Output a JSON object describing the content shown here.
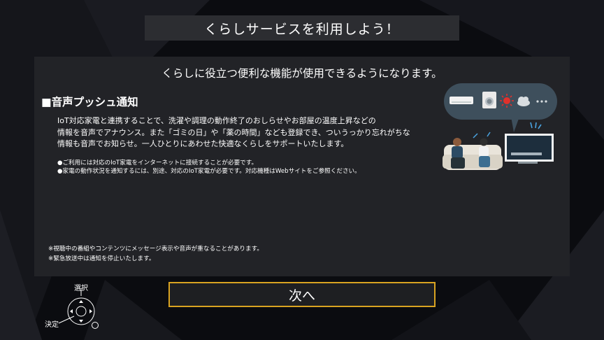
{
  "title": "くらしサービスを利用しよう！",
  "subtitle": "くらしに役立つ便利な機能が使用できるようになります。",
  "section": {
    "heading": "■音声プッシュ通知",
    "description_lines": [
      "IoT対応家電と連携することで、洗濯や調理の動作終了のおしらせやお部屋の温度上昇などの",
      "情報を音声でアナウンス。また「ゴミの日」や「薬の時間」なども登録でき、ついうっかり忘れがちな",
      "情報も音声でお知らせ。一人ひとりにあわせた快適なくらしをサポートいたします。"
    ],
    "notes": [
      "●ご利用には対応のIoT家電をインターネットに接続することが必要です。",
      "●家電の動作状況を通知するには、別途、対応のIoT家電が必要です。対応機種はWebサイトをご参照ください。"
    ]
  },
  "footnotes": [
    "※視聴中の番組やコンテンツにメッセージ表示や音声が重なることがあります。",
    "※緊急放送中は通知を停止いたします。"
  ],
  "next_button": "次へ",
  "remote_hint": {
    "select_label": "選択",
    "enter_label": "決定"
  },
  "colors": {
    "background": "#0b0c10",
    "panel": "#222327",
    "title_bar": "#2c2d31",
    "button_border": "#d9a321",
    "speech_bubble": "#3e4f5c"
  },
  "icons": [
    "air-conditioner-icon",
    "washing-machine-icon",
    "sun-icon",
    "cloud-icon",
    "more-dots-icon",
    "tv-icon",
    "family-on-sofa-illustration",
    "dpad-icon"
  ]
}
